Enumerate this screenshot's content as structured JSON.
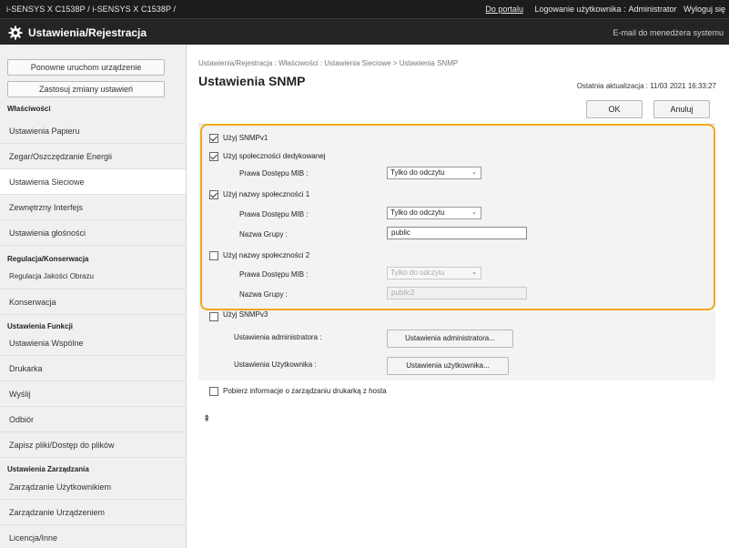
{
  "topbar": {
    "device": "i-SENSYS X C1538P / i-SENSYS X C1538P /",
    "portal": "Do portalu",
    "login_label": "Logowanie użytkownika :",
    "user": "Administrator",
    "logout": "Wyloguj się"
  },
  "titlebar": {
    "title": "Ustawienia/Rejestracja",
    "email": "E-mail do menedżera systemu"
  },
  "sidebar": {
    "btn_restart": "Ponowne uruchom urządzenie",
    "btn_apply": "Zastosuj zmiany ustawień",
    "sections": {
      "properties": "Właściwości",
      "regulation": "Regulacja/Konserwacja",
      "functions": "Ustawienia Funkcji",
      "management": "Ustawienia Zarządzania"
    },
    "items": {
      "paper": "Ustawienia Papieru",
      "timer": "Zegar/Oszczędzanie Energii",
      "network": "Ustawienia Sieciowe",
      "external": "Zewnętrzny Interfejs",
      "volume": "Ustawienia głośności",
      "quality": "Regulacja Jakości Obrazu",
      "maintenance": "Konserwacja",
      "common": "Ustawienia Wspólne",
      "printer": "Drukarka",
      "send": "Wyślij",
      "receive": "Odbiór",
      "store": "Zapisz pliki/Dostęp do plików",
      "users": "Zarządzanie Użytkownikiem",
      "device": "Zarządzanie Urządzeniem",
      "license": "Licencja/Inne"
    }
  },
  "main": {
    "breadcrumb": "Ustawienia/Rejestracja : Właściwości : Ustawienia Sieciowe > Ustawienia SNMP",
    "title": "Ustawienia SNMP",
    "last_update": "Ostatnia aktualizacja : 11/03 2021 16:33:27",
    "ok": "OK",
    "cancel": "Anuluj",
    "snmpv1": "Użyj SNMPv1",
    "dedicated": "Użyj społeczności dedykowanej",
    "mib_label": "Prawa Dostępu MIB :",
    "group_label": "Nazwa Grupy :",
    "community1": "Użyj nazwy społeczności 1",
    "community2": "Użyj nazwy społeczności 2",
    "read_only": "Tylko do odczytu",
    "group1_value": "public",
    "group2_value": "public2",
    "snmpv3": "Użyj SNMPv3",
    "admin_settings_label": "Ustawienia administratora :",
    "admin_settings_btn": "Ustawienia administratora...",
    "user_settings_label": "Ustawienia Użytkownika :",
    "user_settings_btn": "Ustawienia użytkownika...",
    "host_info": "Pobierz informacje o zarządzaniu drukarką z hosta",
    "top_icon": "⇞"
  },
  "colors": {
    "highlight": "#f2a81d",
    "topbar": "#1c1c1c"
  }
}
